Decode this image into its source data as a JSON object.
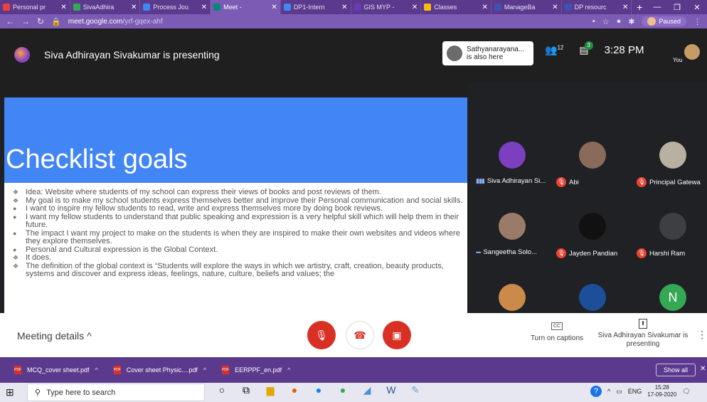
{
  "browser": {
    "tabs": [
      {
        "label": "Personal pr",
        "color": "#ea4335"
      },
      {
        "label": "SivaAdhira",
        "color": "#34a853"
      },
      {
        "label": "Process Jou",
        "color": "#4285f4"
      },
      {
        "label": "Meet - ",
        "color": "#00897b",
        "active": true
      },
      {
        "label": "DP1-Intern",
        "color": "#4285f4"
      },
      {
        "label": "GIS MYP - ",
        "color": "#673ab7"
      },
      {
        "label": "Classes",
        "color": "#fbbc04"
      },
      {
        "label": "ManageBa",
        "color": "#3f51b5"
      },
      {
        "label": "DP resourc",
        "color": "#3f51b5"
      }
    ],
    "new_tab": "+",
    "url_host": "meet.google.com",
    "url_path": "/yrf-gqex-ahf",
    "profile_status": "Paused"
  },
  "meet": {
    "presenting_title": "Siva Adhirayan Sivakumar is presenting",
    "also_here_name": "Sathyanarayana...",
    "also_here_text": "is also here",
    "participant_count": "12",
    "chat_badge": "3",
    "clock": "3:28 PM",
    "you_label": "You"
  },
  "slide": {
    "title": "Checklist goals",
    "bullets": [
      {
        "marker": "❖",
        "text": "Idea: Website where students of my school can express their views of books and post reviews of them."
      },
      {
        "marker": "❖",
        "text": "My goal is to make my school students express themselves better and improve their Personal communication and social skills."
      },
      {
        "marker": "●",
        "text": "I want to inspire my fellow students to read, write and express themselves more by doing book reviews."
      },
      {
        "marker": "●",
        "text": "I want my fellow students to understand that public speaking and expression is a very helpful skill which will help them in their future."
      },
      {
        "marker": "●",
        "text": "The impact I want my project to make on the students is when they are inspired to make their own websites and videos where they explore themselves."
      },
      {
        "marker": "●",
        "text": "Personal and Cultural expression is the Global Context."
      },
      {
        "marker": "❖",
        "text": "It does."
      },
      {
        "marker": "❖",
        "text": "The definition of the global context is “Students will explore the ways in which we artistry, craft, creation, beauty products, systems and discover and express ideas, feelings, nature, culture, beliefs and values; the"
      }
    ]
  },
  "participants": [
    {
      "name": "Siva Adhirayan Si...",
      "indicator": "speaking",
      "avatar_color": "#7b3fbf"
    },
    {
      "name": "Abi",
      "indicator": "muted",
      "avatar_color": "#8a6a5a"
    },
    {
      "name": "Principal Gatewa",
      "indicator": "muted",
      "avatar_color": "#b8b0a0"
    },
    {
      "name": "Sangeetha Solo...",
      "indicator": "more",
      "avatar_color": "#9a7b6a"
    },
    {
      "name": "Jayden Pandian",
      "indicator": "muted",
      "avatar_color": "#111111"
    },
    {
      "name": "Harshi Ram",
      "indicator": "muted",
      "avatar_color": "#3c4043"
    },
    {
      "name": "",
      "indicator": "none",
      "avatar_color": "#c98a4a"
    },
    {
      "name": "",
      "indicator": "none",
      "avatar_color": "#1d4e9a"
    },
    {
      "name": "",
      "indicator": "none",
      "avatar_color": "#34a853",
      "initial": "N"
    }
  ],
  "controls": {
    "meeting_details": "Meeting details",
    "captions_icon": "CC",
    "captions_label": "Turn on captions",
    "presenting_label": "Siva Adhirayan Sivakumar is presenting"
  },
  "downloads": {
    "files": [
      "MCQ_cover sheet.pdf",
      "Cover sheet Physic....pdf",
      "EERPPF_en.pdf"
    ],
    "show_all": "Show all"
  },
  "taskbar": {
    "search_placeholder": "Type here to search",
    "lang": "ENG",
    "time": "15:28",
    "date": "17-09-2020"
  }
}
